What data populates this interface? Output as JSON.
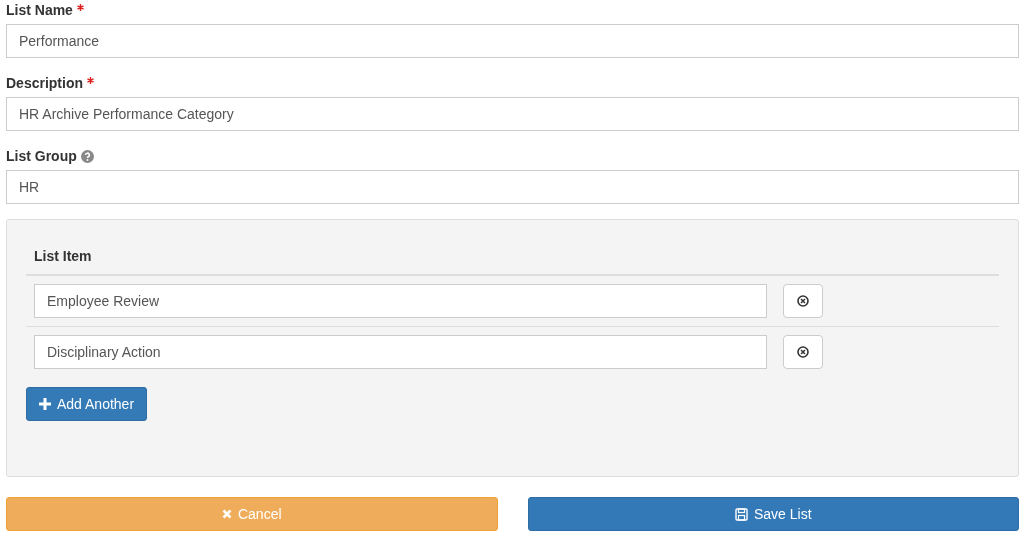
{
  "fields": [
    {
      "label": "List Name",
      "required": true,
      "help": false,
      "value": "Performance"
    },
    {
      "label": "Description",
      "required": true,
      "help": false,
      "value": "HR Archive Performance Category"
    },
    {
      "label": "List Group",
      "required": false,
      "help": true,
      "value": "HR"
    }
  ],
  "list_items": {
    "header": "List Item",
    "items": [
      {
        "value": "Employee Review"
      },
      {
        "value": "Disciplinary Action"
      }
    ],
    "add_button": "Add Another"
  },
  "buttons": [
    {
      "kind": "cancel",
      "label": "Cancel"
    },
    {
      "kind": "save",
      "label": "Save List"
    }
  ]
}
